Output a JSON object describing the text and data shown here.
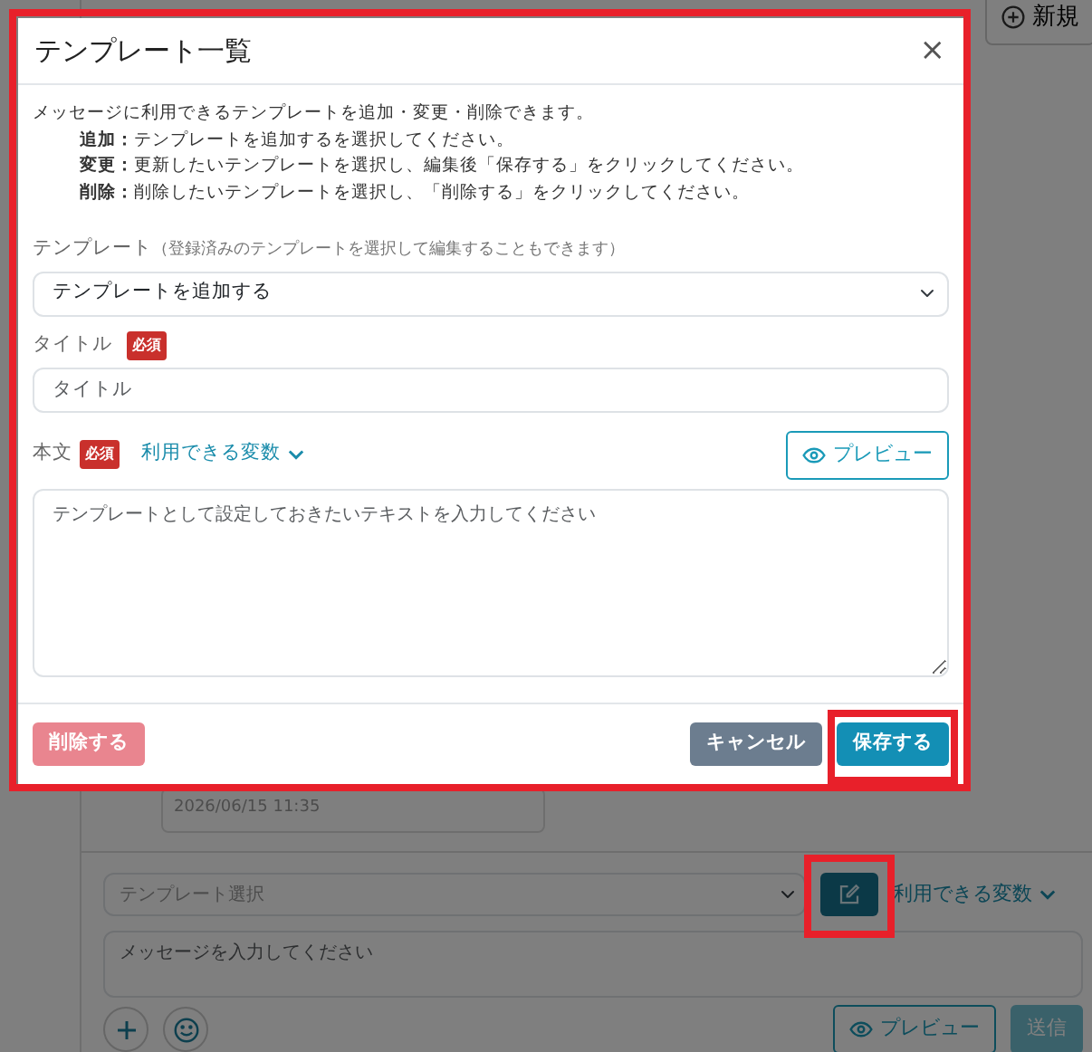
{
  "background": {
    "new_button": "新規",
    "message": {
      "timestamp": "2026/06/15 11:35"
    },
    "composer": {
      "template_select": "テンプレート選択",
      "edit_button": {
        "highlighted": true
      },
      "variables": "利用できる変数",
      "message_placeholder": "メッセージを入力してください",
      "preview_button": "プレビュー",
      "send_button": {
        "label": "送信",
        "disabled": true
      }
    }
  },
  "dialog": {
    "title": "テンプレート一覧",
    "close": "×",
    "highlighted": true,
    "intro": "メッセージに利用できるテンプレートを追加・変更・削除できます。",
    "instructions": [
      "**追加：**テンプレートを追加するを選択してください。",
      "**変更：**更新したいテンプレートを選択し、編集後「保存する」をクリックしてください。",
      "**削除：**削除したいテンプレートを選択し、「削除する」をクリックしてください。"
    ],
    "template_label": "テンプレート",
    "template_hint": "（登録済みのテンプレートを選択して編集することもできます）",
    "template_value": "テンプレートを追加する",
    "title_label": "タイトル",
    "title_required": "必須",
    "title_placeholder": "タイトル",
    "body_label": "本文",
    "body_required": "必須",
    "variables": "利用できる変数",
    "preview_button": "プレビュー",
    "body_placeholder": "テンプレートとして設定しておきたいテキストを入力してください",
    "buttons": [
      {
        "label": "削除する",
        "kind": "danger",
        "disabled": true,
        "highlighted": false
      },
      {
        "label": "キャンセル",
        "kind": "secondary",
        "disabled": false,
        "highlighted": false
      },
      {
        "label": "保存する",
        "kind": "primary",
        "disabled": false,
        "highlighted": true
      }
    ]
  }
}
